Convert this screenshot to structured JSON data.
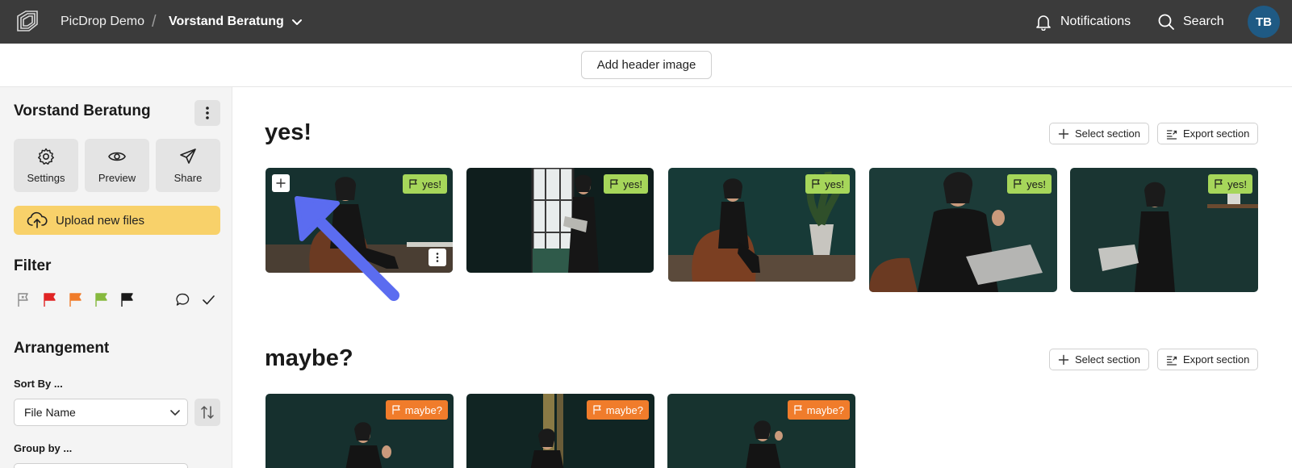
{
  "topbar": {
    "brand": "PicDrop Demo",
    "separator": "/",
    "project": "Vorstand Beratung",
    "notifications_label": "Notifications",
    "search_label": "Search",
    "avatar_initials": "TB"
  },
  "header_band": {
    "add_header_label": "Add header image"
  },
  "sidebar": {
    "title": "Vorstand Beratung",
    "actions": [
      {
        "label": "Settings",
        "icon": "gear-icon"
      },
      {
        "label": "Preview",
        "icon": "eye-icon"
      },
      {
        "label": "Share",
        "icon": "send-icon"
      }
    ],
    "upload_label": "Upload new files",
    "filter_title": "Filter",
    "flags": [
      {
        "icon": "flag-none-icon",
        "color": "#8a8a8a"
      },
      {
        "icon": "flag-red-icon",
        "color": "#e02424"
      },
      {
        "icon": "flag-orange-icon",
        "color": "#f07c2b"
      },
      {
        "icon": "flag-green-icon",
        "color": "#86b93e"
      },
      {
        "icon": "flag-black-icon",
        "color": "#1a1a1a"
      }
    ],
    "arrangement_title": "Arrangement",
    "sort_label": "Sort By ...",
    "sort_value": "File Name",
    "group_label": "Group by ..."
  },
  "sections": [
    {
      "title": "yes!",
      "select_label": "Select section",
      "export_label": "Export section",
      "badge": "yes!"
    },
    {
      "title": "maybe?",
      "select_label": "Select section",
      "export_label": "Export section",
      "badge": "maybe?"
    }
  ],
  "colors": {
    "topbar": "#3b3b3b",
    "avatar": "#1f5a84",
    "upload": "#f8d16a",
    "badge_yes": "#a6d65a",
    "badge_maybe": "#f07c2b",
    "arrow": "#5b6cf0"
  }
}
